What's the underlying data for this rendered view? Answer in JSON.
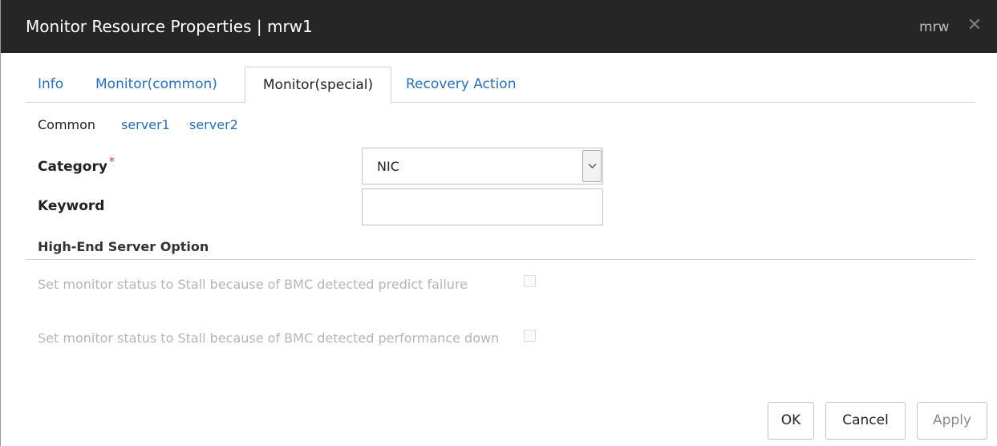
{
  "window": {
    "title": "Monitor Resource Properties | mrw1",
    "user": "mrw",
    "close_icon": "close-icon"
  },
  "tabs": [
    {
      "label": "Info",
      "active": false
    },
    {
      "label": "Monitor(common)",
      "active": false
    },
    {
      "label": "Monitor(special)",
      "active": true
    },
    {
      "label": "Recovery Action",
      "active": false
    }
  ],
  "subnav": {
    "current": "Common",
    "links": [
      "server1",
      "server2"
    ]
  },
  "form": {
    "category_label": "Category",
    "required_mark": "*",
    "category_value": "NIC",
    "keyword_label": "Keyword",
    "keyword_value": ""
  },
  "high_end": {
    "heading": "High-End Server Option",
    "options": [
      {
        "label": "Set monitor status to Stall because of BMC detected predict failure",
        "checked": false,
        "disabled": true
      },
      {
        "label": "Set monitor status to Stall because of BMC detected performance down",
        "checked": false,
        "disabled": true
      }
    ]
  },
  "buttons": {
    "ok": "OK",
    "cancel": "Cancel",
    "apply": "Apply"
  },
  "colors": {
    "titlebar": "#262626",
    "link": "#2a6fb5",
    "required": "#d9302c",
    "disabled_text": "#b5b5b5"
  }
}
